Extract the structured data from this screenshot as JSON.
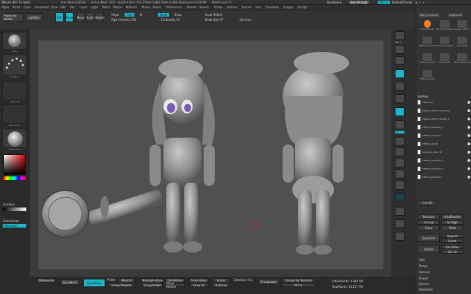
{
  "title_bar": {
    "app": "ZBrush 4R7 P3 (x64)",
    "mem": "Free Mem 2.87GB",
    "active": "Active Mem 1957",
    "scratch": "Scratch Disk 759",
    "ztime": "ZTime 1.881",
    "timer": "Timer 0.089",
    "polys": "PolyCount 4.931 MP",
    "mesh": "MeshCount 17",
    "quicksave": "QuickSave",
    "seethrough": "See-through",
    "seethrough_val": "0",
    "menus_btn": "Menus",
    "script": "DefaultZScript"
  },
  "menubar": [
    "Alpha",
    "Brush",
    "Color",
    "Document",
    "Draw",
    "Edit",
    "File",
    "Layer",
    "Light",
    "Macro",
    "Marker",
    "Material",
    "Movie",
    "Picker",
    "Preferences",
    "Render",
    "Stencil",
    "Stroke",
    "Surface",
    "Texture",
    "Tool",
    "Transform",
    "Zplugin",
    "Zscript"
  ],
  "toolbar": {
    "projection": "Projection Master",
    "lightbox": "LightBox",
    "edit": "Edit",
    "draw": "Draw",
    "move": "Move",
    "scale": "Scale",
    "rotate": "Rotate",
    "mrgb": "Mrgb",
    "rgb": "Rgb",
    "m": "M",
    "rgb_intensity": "Rgb Intensity 100",
    "zadd": "Zadd",
    "zsub": "Zsub",
    "z_intensity": "Z Intensity 25",
    "focal_shift": "Focal Shift 0",
    "draw_size": "Draw Size 97",
    "dynamic": "Dynamic"
  },
  "left": {
    "brush_label": "Move",
    "stroke_label": "DragRect",
    "alpha_label": "Alpha Off",
    "texture_label": "Texture Off",
    "material_label": "SkinShade4",
    "gradient": "Gradient",
    "switch_color": "SwitchColor",
    "alternate": "Alternate"
  },
  "right": {
    "bpr": "BPR",
    "spix": "SPix 3",
    "scroll": "Scroll",
    "zoom": "Zoom",
    "actual": "Actual",
    "aahalf": "AAHalf",
    "persp": "Persp",
    "floor": "Floor",
    "local": "Local",
    "lsym": "L.Sym",
    "xyz": "Xyz",
    "frame": "Frame",
    "move": "Move",
    "scale": "Scale",
    "rotate": "Rotate",
    "linefill": "Line Fill PolyF",
    "transp": "Transp",
    "ghost": "Ghost",
    "solo": "Solo",
    "xpose": "Xpose"
  },
  "panel": {
    "header": [
      "PM3D_Cylinder3D",
      "PolyBrush3D"
    ],
    "tools": [
      {
        "label": "SimpleBrush"
      },
      {
        "label": "PM3D_Cylinder3D"
      },
      {
        "label": "Merged_CHAR_Gi"
      },
      {
        "label": "PM3D_Cylinder3D"
      },
      {
        "label": "PM3D_Cylinder3D"
      },
      {
        "label": "Cylinder3D"
      },
      {
        "label": "TBrib_Cylinder3D"
      },
      {
        "label": "Cylinder3D"
      },
      {
        "label": "PM3D_Sphere3D"
      },
      {
        "label": "PM3D_Cube3D"
      }
    ],
    "subtool_header": "SubTool",
    "subtools": [
      "PM3D_Cyl...",
      "Merged_PM3D_Cylinder3D",
      "Merged_PM3D_Cube3D_1",
      "PM3D_Cylinder3D_1",
      "PM3D_Cylinder3D",
      "PM3D_Cube3D",
      "Sticks_Sm_Bar_HP",
      "PM3D_Cylinder3D_1",
      "PM3D_Cylinder3D_2",
      "PM3D_Sphere3D_1"
    ],
    "list_all": "List All",
    "autoreorder": "AutoReorder",
    "all_low": "All Low",
    "all_high": "All High",
    "copy": "Copy",
    "paste": "Paste",
    "rename": "Rename",
    "duplicate": "Duplicate",
    "append": "Append",
    "insert": "Insert",
    "delete": "Delete",
    "del_other": "Del Other",
    "del_all": "Del All",
    "split": "Split",
    "merge": "Merge",
    "remesh": "Remesh",
    "project": "Project",
    "extract": "Extract",
    "geometry": "Geometry"
  },
  "bottom": {
    "zremesher": "ZRemesher",
    "dynamesh": "DynaMesh",
    "polish": "Polish",
    "polish_val": "0",
    "group_masked": "Group Masked",
    "mask_all": "MaskAll",
    "smt": "Smt",
    "mask_by_feature": "MaskByFeature",
    "group_visible": "GroupVisible",
    "del_hidden": "Del Hidden",
    "show_hidden": "Show Hidden",
    "close_holes": "Close Holes",
    "grow_all": "Grow All",
    "shrink": "Shrink",
    "outgrow": "OutGrow",
    "clearance": "Clearance 0.1",
    "group_loops": "GroupLoops",
    "groups_by_normals": "Groups By Normals",
    "mirror": "Mirror",
    "active_points": "ActivePoints: 1.464 Mil",
    "total_points": "TotalPoints: 13.217 Mil"
  },
  "colors": {
    "accent": "#1eb5c7",
    "brush_highlight": "#f08020",
    "viewport": "#505050",
    "eye_iris": "#7a5ab8"
  }
}
